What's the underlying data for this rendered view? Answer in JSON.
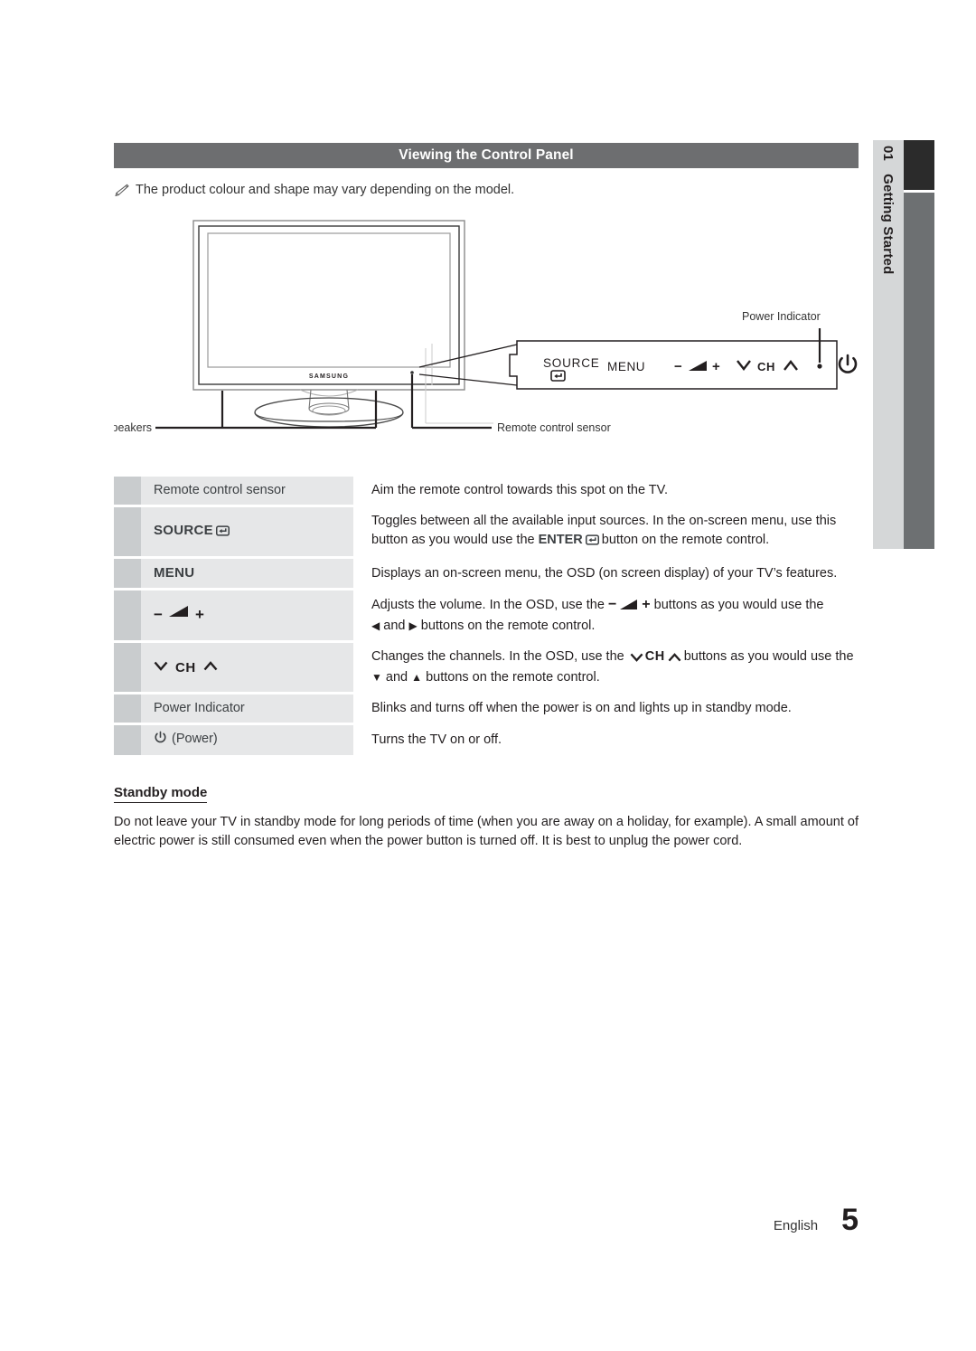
{
  "section": {
    "header_title": "Viewing the Control Panel",
    "note_icon": "pencil-note-icon",
    "note_text": "The product colour and shape may vary depending on the model."
  },
  "sidetab": {
    "number": "01",
    "label": "Getting Started"
  },
  "figure": {
    "brand_label": "SAMSUNG",
    "callouts": {
      "speakers": "Speakers",
      "remote_sensor": "Remote control sensor",
      "power_indicator": "Power Indicator"
    },
    "panel_buttons": {
      "source": "SOURCE",
      "source_icon": "enter-return-icon",
      "menu": "MENU",
      "volume_minus": "−",
      "volume_icon": "volume-wedge-icon",
      "volume_plus": "+",
      "ch_down_icon": "chevron-down-icon",
      "ch": "CH",
      "ch_up_icon": "chevron-up-icon",
      "indicator_dot_icon": "power-indicator-dot-icon",
      "power_icon": "power-button-icon"
    }
  },
  "table": {
    "rows": [
      {
        "key_text": "Remote control sensor",
        "key_style": "plain",
        "key_icon": "",
        "desc_lines": [
          "Aim the remote control towards this spot on the TV."
        ]
      },
      {
        "key_text": "SOURCE",
        "key_style": "strong",
        "key_icon": "enter-return-icon",
        "desc_lines": [
          "Toggles between all the available input sources. In the on-screen menu, use this",
          "button as you would use the ENTER↵ button on the remote control."
        ],
        "desc_emphasis": "ENTER"
      },
      {
        "key_text": "MENU",
        "key_style": "strong",
        "key_icon": "",
        "desc_lines": [
          "Displays an on-screen menu, the OSD (on screen display) of your TV’s features."
        ]
      },
      {
        "key_text": "− ◢ +",
        "key_style": "strong",
        "key_icon": "volume-wedge-icon",
        "desc_lines": [
          "Adjusts the volume. In the OSD, use the − ◢ + buttons as you would use the",
          "◀ and ▶ buttons on the remote control."
        ]
      },
      {
        "key_text": "∨ CH ∧",
        "key_style": "strong",
        "key_icon": "chevron-pair-icon",
        "desc_lines": [
          "Changes the channels. In the OSD, use the ∨ CH ∧ buttons as you would use the",
          "▼ and ▲ buttons on the remote control."
        ]
      },
      {
        "key_text": "Power Indicator",
        "key_style": "plain",
        "key_icon": "",
        "desc_lines": [
          "Blinks and turns off when the power is on and lights up in standby mode."
        ]
      },
      {
        "key_text": "(Power)",
        "key_style": "plain",
        "key_icon": "power-button-icon",
        "desc_lines": [
          "Turns the TV on or off."
        ]
      }
    ]
  },
  "standby": {
    "title": "Standby mode",
    "body": "Do not leave your TV in standby mode for long periods of time (when you are away on a holiday, for example). A small amount of electric power is still consumed even when the power button is turned off. It is best to unplug the power cord."
  },
  "footer": {
    "language": "English",
    "page_number": "5"
  },
  "colors": {
    "header_bar": "#6d6e70",
    "tab_label_bg": "#d5d7d8",
    "tab_dark": "#2b2b2b",
    "tab_gray": "#6d7072",
    "row_gutter": "#c9ccce",
    "row_key_bg": "#e6e7e8",
    "text": "#231f20"
  }
}
